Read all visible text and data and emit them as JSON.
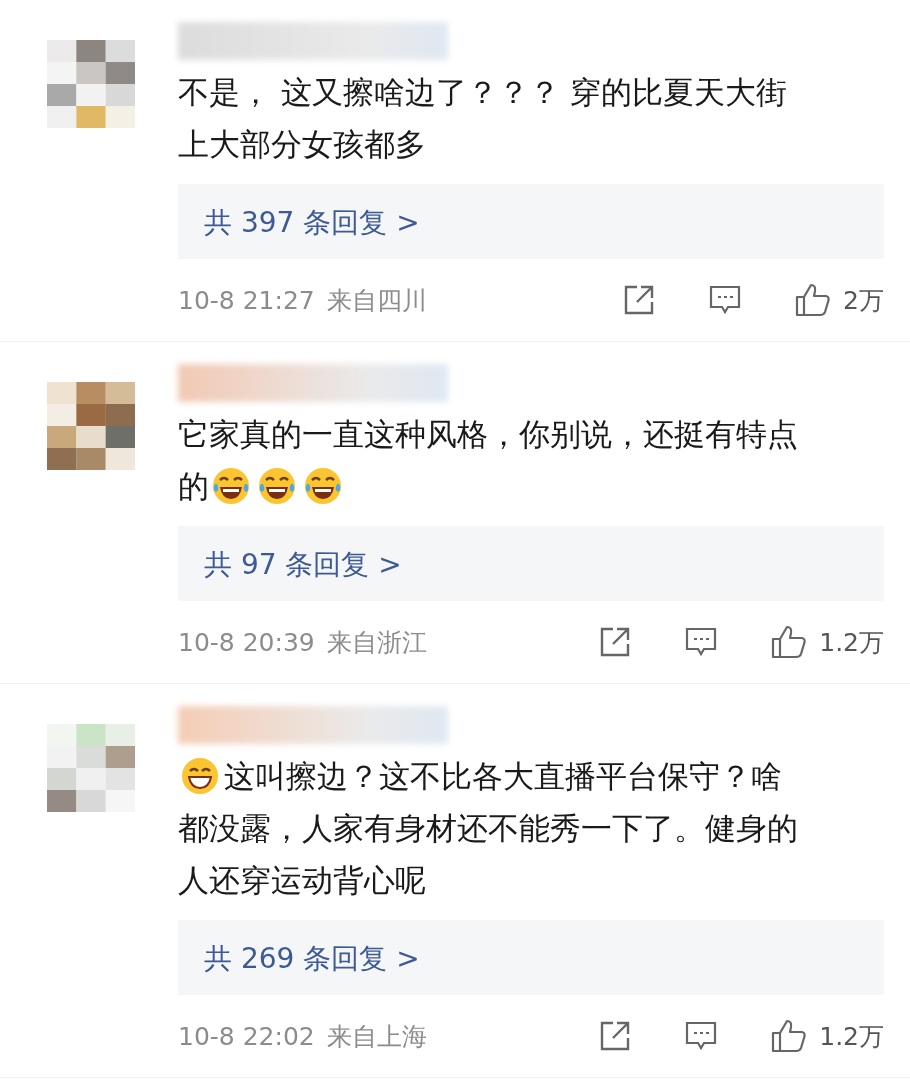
{
  "comments": [
    {
      "lines": [
        [
          {
            "kind": "text",
            "text": "不是， 这又擦啥边了？？？ 穿的比夏天大街"
          }
        ],
        [
          {
            "kind": "text",
            "text": "上大部分女孩都多"
          }
        ]
      ],
      "replies": "共 397 条回复 >",
      "time": "10-8 21:27",
      "location": "来自四川",
      "likes": "2万"
    },
    {
      "lines": [
        [
          {
            "kind": "text",
            "text": "它家真的一直这种风格，你别说，还挺有特点"
          }
        ],
        [
          {
            "kind": "text",
            "text": "的"
          },
          {
            "kind": "tears-of-joy"
          },
          {
            "kind": "tears-of-joy"
          },
          {
            "kind": "tears-of-joy"
          }
        ]
      ],
      "replies": "共 97 条回复 >",
      "time": "10-8 20:39",
      "location": "来自浙江",
      "likes": "1.2万"
    },
    {
      "lines": [
        [
          {
            "kind": "grin"
          },
          {
            "kind": "text",
            "text": "这叫擦边？这不比各大直播平台保守？啥"
          }
        ],
        [
          {
            "kind": "text",
            "text": "都没露，人家有身材还不能秀一下了。健身的"
          }
        ],
        [
          {
            "kind": "text",
            "text": "人还穿运动背心呢"
          }
        ]
      ],
      "replies": "共 269 条回复 >",
      "time": "10-8 22:02",
      "location": "来自上海",
      "likes": "1.2万"
    }
  ]
}
